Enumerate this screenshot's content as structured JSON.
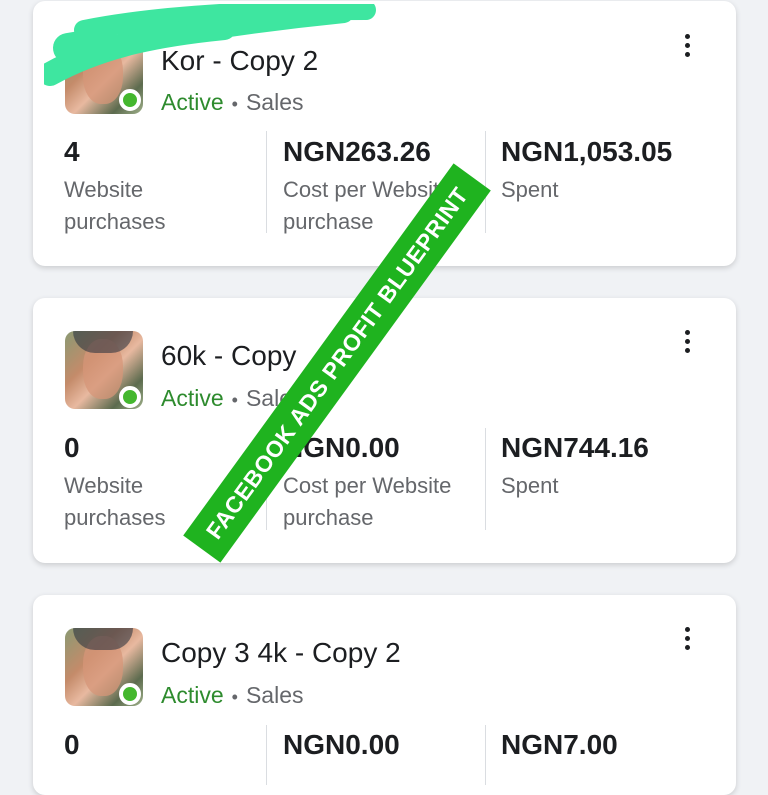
{
  "ads": [
    {
      "name": "Kor - Copy 2",
      "status": "Active",
      "objective": "Sales",
      "metrics": [
        {
          "value": "4",
          "label": "Website\npurchases"
        },
        {
          "value": "NGN263.26",
          "label": "Cost per Website\npurchase"
        },
        {
          "value": "NGN1,053.05",
          "label": "Spent"
        }
      ]
    },
    {
      "name": "60k - Copy",
      "status": "Active",
      "objective": "Sales",
      "metrics": [
        {
          "value": "0",
          "label": "Website\npurchases"
        },
        {
          "value": "NGN0.00",
          "label": "Cost per Website\npurchase"
        },
        {
          "value": "NGN744.16",
          "label": "Spent"
        }
      ]
    },
    {
      "name": "Copy 3 4k - Copy 2",
      "status": "Active",
      "objective": "Sales",
      "metrics": [
        {
          "value": "0",
          "label": ""
        },
        {
          "value": "NGN0.00",
          "label": ""
        },
        {
          "value": "NGN7.00",
          "label": ""
        }
      ]
    }
  ],
  "separator": "•",
  "watermark": "FACEBOOK ADS PROFIT BLUEPRINT",
  "colors": {
    "active_green": "#2e8b2e",
    "status_dot": "#44b72e",
    "watermark_bg": "#1fb31f",
    "scribble": "#3ee6a0"
  }
}
